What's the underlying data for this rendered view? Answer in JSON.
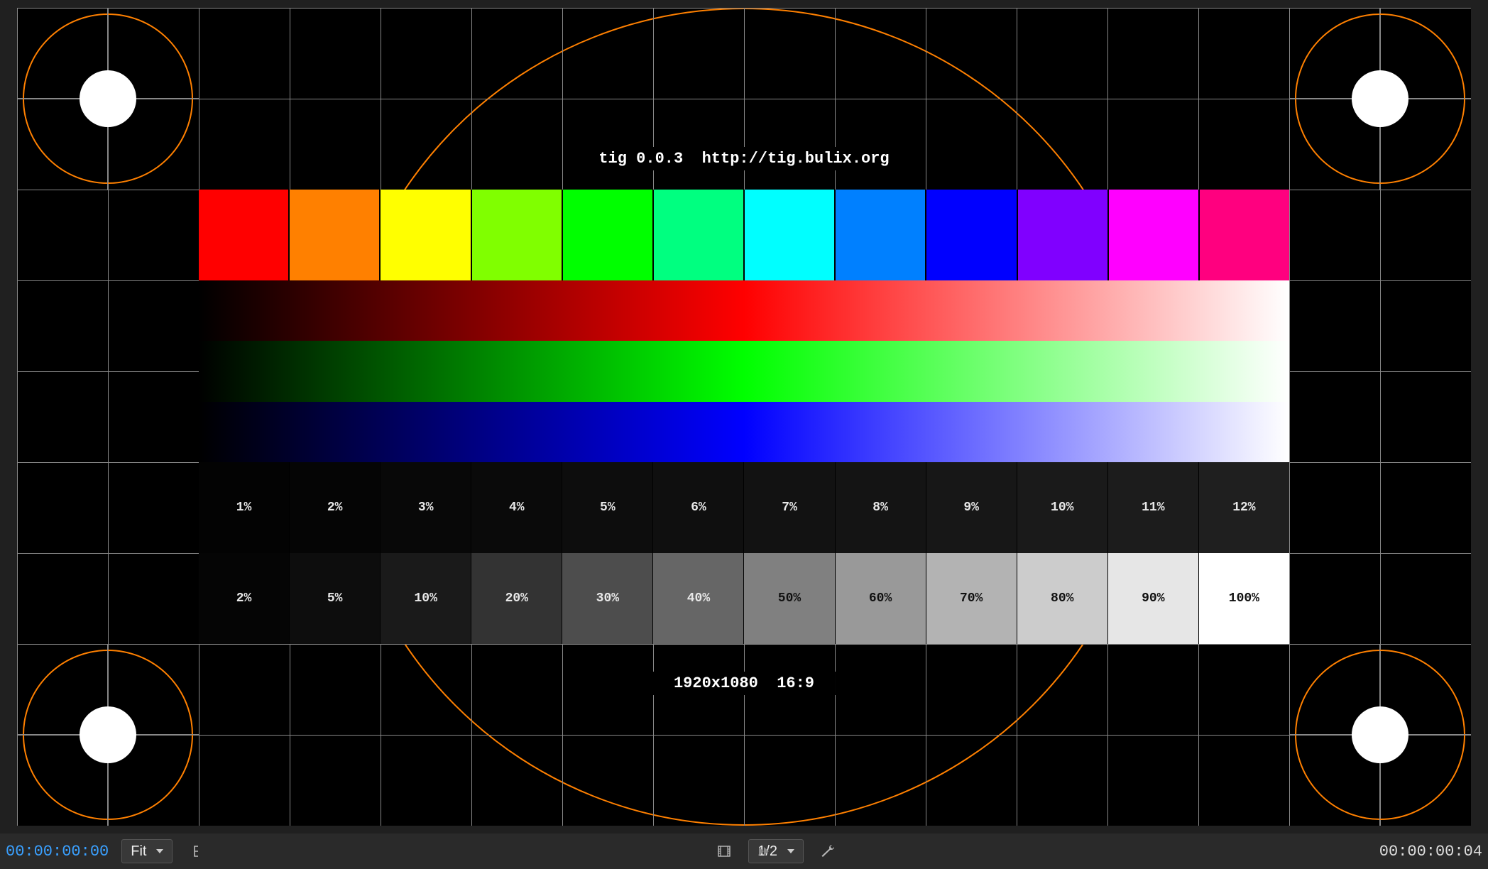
{
  "card": {
    "title_line": "tig 0.0.3  http://tig.bulix.org",
    "footer_line": "1920x1080  16:9",
    "hue_colors": [
      "#ff0000",
      "#ff8000",
      "#ffff00",
      "#80ff00",
      "#00ff00",
      "#00ff80",
      "#00ffff",
      "#0080ff",
      "#0000ff",
      "#8000ff",
      "#ff00ff",
      "#ff007f"
    ],
    "low_gray": {
      "labels": [
        "1%",
        "2%",
        "3%",
        "4%",
        "5%",
        "6%",
        "7%",
        "8%",
        "9%",
        "10%",
        "11%",
        "12%"
      ],
      "values": [
        1,
        2,
        3,
        4,
        5,
        6,
        7,
        8,
        9,
        10,
        11,
        12
      ]
    },
    "full_gray": {
      "labels": [
        "2%",
        "5%",
        "10%",
        "20%",
        "30%",
        "40%",
        "50%",
        "60%",
        "70%",
        "80%",
        "90%",
        "100%"
      ],
      "values": [
        2,
        5,
        10,
        20,
        30,
        40,
        50,
        60,
        70,
        80,
        90,
        100
      ]
    }
  },
  "status": {
    "tc_in": "00:00:00:00",
    "zoom_label": "Fit",
    "res_label": "1/2",
    "tc_out": "00:00:00:04"
  }
}
